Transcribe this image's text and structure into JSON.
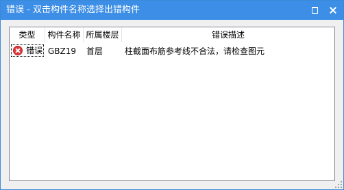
{
  "window": {
    "title": "错误 - 双击构件名称选择出错构件"
  },
  "table": {
    "columns": [
      "类型",
      "构件名称",
      "所属楼层",
      "错误描述"
    ],
    "rows": [
      {
        "type": "错误",
        "type_icon": "error-icon",
        "name": "GBZ19",
        "floor": "首层",
        "description": "柱截面布筋参考线不合法，请检查图元"
      }
    ]
  },
  "colors": {
    "titlebar": "#3c8ee6",
    "error_icon": "#e0393b"
  }
}
